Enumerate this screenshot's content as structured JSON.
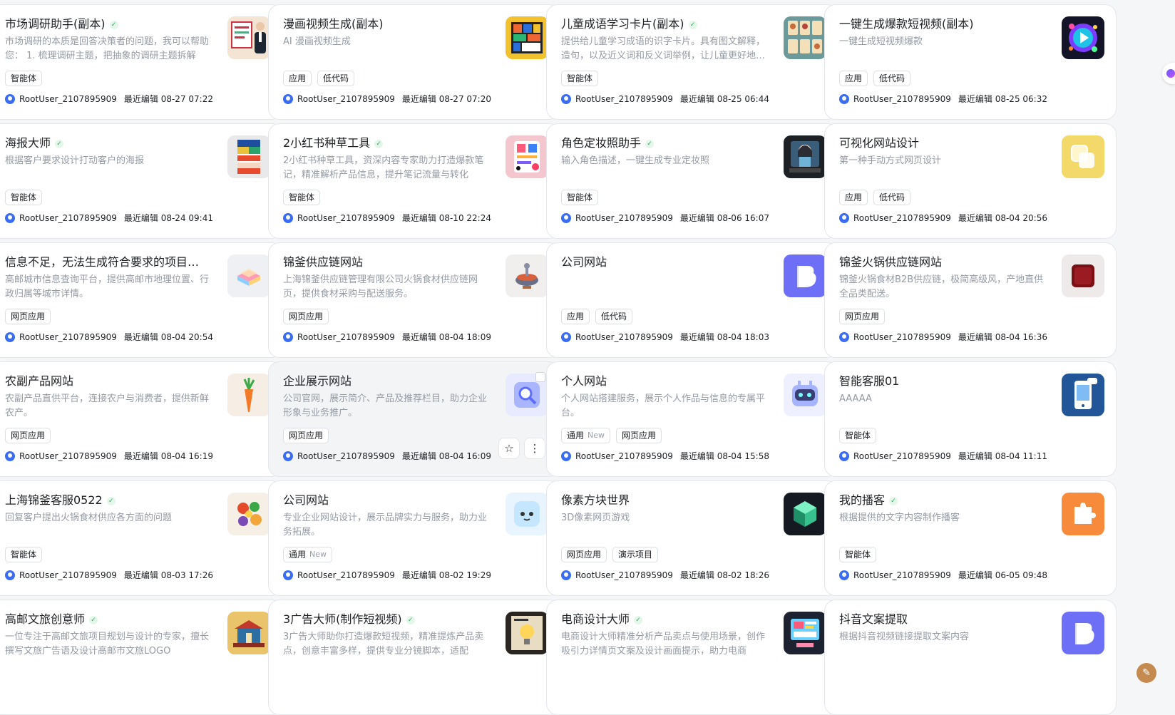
{
  "cards": [
    {
      "title": "市场调研助手(副本)",
      "verified": true,
      "desc": "市场调研的本质是回答决策者的问题，我可以帮助您： 1. 梳理调研主题，把抽象的调研主题拆解",
      "tags": [
        {
          "label": "智能体"
        }
      ],
      "user": "RootUser_2107895909",
      "edited": "最近编辑 08-27 07:22",
      "icon": "business-presenter-icon"
    },
    {
      "title": "漫画视频生成(副本)",
      "verified": false,
      "desc": "AI 漫画视频生成",
      "tags": [
        {
          "label": "应用"
        },
        {
          "label": "低代码"
        }
      ],
      "user": "RootUser_2107895909",
      "edited": "最近编辑 08-27 07:20",
      "icon": "comic-panels-icon"
    },
    {
      "title": "儿童成语学习卡片(副本)",
      "verified": true,
      "desc": "提供给儿童学习成语的识字卡片。具有图文解释，造句，以及近义词和反义词举例，让儿童更好地学习",
      "tags": [
        {
          "label": "智能体"
        }
      ],
      "user": "RootUser_2107895909",
      "edited": "最近编辑 08-25 06:44",
      "icon": "idiom-cards-icon"
    },
    {
      "title": "一键生成爆款短视频(副本)",
      "verified": false,
      "desc": "一键生成短视频爆款",
      "tags": [
        {
          "label": "应用"
        },
        {
          "label": "低代码"
        }
      ],
      "user": "RootUser_2107895909",
      "edited": "最近编辑 08-25 06:32",
      "icon": "play-burst-icon"
    },
    {
      "title": "海报大师",
      "verified": true,
      "desc": "根据客户要求设计打动客户的海报",
      "tags": [
        {
          "label": "智能体"
        }
      ],
      "user": "RootUser_2107895909",
      "edited": "最近编辑 08-24 09:41",
      "icon": "poster-icon"
    },
    {
      "title": "2小红书种草工具",
      "verified": true,
      "desc": "2小红书种草工具，资深内容专家助力打造爆款笔记，精准解析产品信息，提升笔记流量与转化",
      "tags": [
        {
          "label": "智能体"
        }
      ],
      "user": "RootUser_2107895909",
      "edited": "最近编辑 08-10 22:24",
      "icon": "social-notes-icon"
    },
    {
      "title": "角色定妆照助手",
      "verified": true,
      "desc": "输入角色描述，一键生成专业定妆照",
      "tags": [
        {
          "label": "智能体"
        }
      ],
      "user": "RootUser_2107895909",
      "edited": "最近编辑 08-06 16:07",
      "icon": "character-portrait-icon"
    },
    {
      "title": "可视化网站设计",
      "verified": false,
      "desc": "第一种手动方式网页设计",
      "tags": [
        {
          "label": "应用"
        },
        {
          "label": "低代码"
        }
      ],
      "user": "RootUser_2107895909",
      "edited": "最近编辑 08-04 20:56",
      "icon": "copy-squares-icon"
    },
    {
      "title": "信息不足，无法生成符合要求的项目名称",
      "verified": false,
      "desc": "高邮城市信息查询平台，提供高邮市地理位置、行政归属等城市详情。",
      "tags": [
        {
          "label": "网页应用"
        }
      ],
      "user": "RootUser_2107895909",
      "edited": "最近编辑 08-04 20:54",
      "icon": "layered-cube-icon"
    },
    {
      "title": "锦釜供应链网站",
      "verified": false,
      "desc": "上海锦釜供应链管理有限公司火锅食材供应链网页，提供食材采购与配送服务。",
      "tags": [
        {
          "label": "网页应用"
        }
      ],
      "user": "RootUser_2107895909",
      "edited": "最近编辑 08-04 18:09",
      "icon": "hotpot-icon"
    },
    {
      "title": "公司网站",
      "verified": false,
      "desc": "",
      "tags": [
        {
          "label": "应用"
        },
        {
          "label": "低代码"
        }
      ],
      "user": "RootUser_2107895909",
      "edited": "最近编辑 08-04 18:03",
      "icon": "app-default-icon"
    },
    {
      "title": "锦釜火锅供应链网站",
      "verified": false,
      "desc": "锦釜火锅食材B2B供应链，极简高级风，产地直供全品类配送。",
      "tags": [
        {
          "label": "网页应用"
        }
      ],
      "user": "RootUser_2107895909",
      "edited": "最近编辑 08-04 16:36",
      "icon": "red-cube-icon"
    },
    {
      "title": "农副产品网站",
      "verified": false,
      "desc": "农副产品直供平台，连接农户与消费者，提供新鲜农产。",
      "tags": [
        {
          "label": "网页应用"
        }
      ],
      "user": "RootUser_2107895909",
      "edited": "最近编辑 08-04 16:19",
      "icon": "carrot-icon"
    },
    {
      "title": "企业展示网站",
      "verified": false,
      "desc": "公司官网，展示简介、产品及推荐栏目，助力企业形象与业务推广。",
      "tags": [
        {
          "label": "网页应用"
        }
      ],
      "user": "RootUser_2107895909",
      "edited": "最近编辑 08-04 16:09",
      "icon": "magnifier-cube-icon",
      "hover": true
    },
    {
      "title": "个人网站",
      "verified": false,
      "desc": "个人网站搭建服务，展示个人作品与信息的专属平台。",
      "tags": [
        {
          "label": "通用",
          "new": "New"
        },
        {
          "label": "网页应用"
        }
      ],
      "user": "RootUser_2107895909",
      "edited": "最近编辑 08-04 15:58",
      "icon": "robot-face-icon"
    },
    {
      "title": "智能客服01",
      "verified": false,
      "desc": "AAAAA",
      "tags": [
        {
          "label": "智能体"
        }
      ],
      "user": "RootUser_2107895909",
      "edited": "最近编辑 08-04 11:11",
      "icon": "phone-chat-icon"
    },
    {
      "title": "上海锦釜客服0522",
      "verified": true,
      "desc": "回复客户提出火锅食材供应各方面的问题",
      "tags": [
        {
          "label": "智能体"
        }
      ],
      "user": "RootUser_2107895909",
      "edited": "最近编辑 08-03 17:26",
      "icon": "vegetables-icon"
    },
    {
      "title": "公司网站",
      "verified": false,
      "desc": "专业企业网站设计，展示品牌实力与服务，助力业务拓展。",
      "tags": [
        {
          "label": "通用",
          "new": "New"
        }
      ],
      "user": "RootUser_2107895909",
      "edited": "最近编辑 08-02 19:29",
      "icon": "cute-face-icon"
    },
    {
      "title": "像素方块世界",
      "verified": false,
      "desc": "3D像素网页游戏",
      "tags": [
        {
          "label": "网页应用"
        },
        {
          "label": "演示项目"
        }
      ],
      "user": "RootUser_2107895909",
      "edited": "最近编辑 08-02 18:26",
      "icon": "pixel-cube-icon"
    },
    {
      "title": "我的播客",
      "verified": true,
      "desc": "根据提供的文字内容制作播客",
      "tags": [
        {
          "label": "智能体"
        }
      ],
      "user": "RootUser_2107895909",
      "edited": "最近编辑 06-05 09:48",
      "icon": "puzzle-icon"
    },
    {
      "title": "高邮文旅创意师",
      "verified": true,
      "desc": "一位专注于高邮文旅项目规划与设计的专家，擅长撰写文旅广告语及设计高邮市文旅LOGO",
      "tags": [],
      "user": "",
      "edited": "",
      "icon": "temple-icon"
    },
    {
      "title": "3广告大师(制作短视频)",
      "verified": true,
      "desc": "3广告大师助你打造爆款短视频，精准提炼产品卖点，创意丰富多样，提供专业分镜脚本，适配",
      "tags": [],
      "user": "",
      "edited": "",
      "icon": "lightbulb-poster-icon"
    },
    {
      "title": "电商设计大师",
      "verified": true,
      "desc": "电商设计大师精准分析产品卖点与使用场景，创作吸引力详情页文案及设计画面提示，助力电商",
      "tags": [],
      "user": "",
      "edited": "",
      "icon": "storefront-icon"
    },
    {
      "title": "抖音文案提取",
      "verified": false,
      "desc": "根据抖音视频链接提取文案内容",
      "tags": [],
      "user": "",
      "edited": "",
      "icon": "app-default-icon"
    }
  ]
}
